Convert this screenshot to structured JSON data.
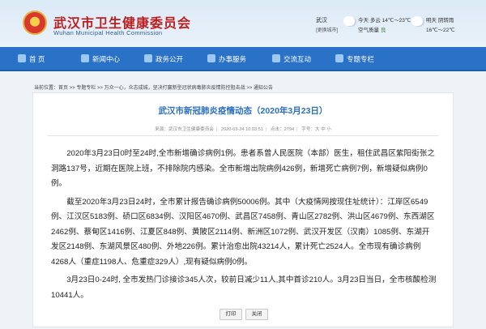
{
  "header": {
    "site_name_cn": "武汉市卫生健康委员会",
    "site_name_en": "Wuhan Municipal Health Commission",
    "weather": {
      "city": "武汉",
      "city_sub": "[更换城市]",
      "today_label": "今天",
      "today_desc": "多云",
      "today_temp": "14℃～23℃",
      "aqi_label": "空气质量",
      "aqi_value": "良",
      "tomorrow_label": "明天",
      "tomorrow_desc": "阴转雨",
      "tomorrow_temp": "16℃～22℃"
    }
  },
  "nav": {
    "items": [
      {
        "label": "首 页",
        "icon": "home-icon"
      },
      {
        "label": "新闻中心",
        "icon": "megaphone-icon"
      },
      {
        "label": "政务公开",
        "icon": "document-icon"
      },
      {
        "label": "办事服务",
        "icon": "screen-icon"
      },
      {
        "label": "交流互动",
        "icon": "chat-icon"
      },
      {
        "label": "专题专栏",
        "icon": "lightbulb-icon"
      }
    ]
  },
  "breadcrumb": "当前位置：首页 >> 专题专栏 >> 万众一心，众志成城，坚决打赢新型冠状病毒肺炎疫情防控阻击战 >> 通知公告",
  "article": {
    "title": "武汉市新冠肺炎疫情动态（2020年3月23日）",
    "meta_source": "来源：武汉市卫生健康委员会",
    "meta_date": "2020-03-24 10:03:51",
    "meta_views_label": "点击：",
    "meta_views": "2794",
    "meta_font_label": "字号：",
    "meta_font_opts": "大 中 小",
    "paragraphs": [
      "2020年3月23日0时至24时,全市新增确诊病例1例。患者系曾人民医院（本部）医生，租住武昌区紫阳街张之洞路137号，近期在医院上班，不排除院内感染。全市新增出院病例426例，新增死亡病例7例，新增疑似病例0例。",
      "截至2020年3月23日24时，全市累计报告确诊病例50006例。其中（大疫情网按现住址统计）：江岸区6549例、江汉区5183例、硚口区6834例、汉阳区4670例、武昌区7458例、青山区2782例、洪山区4679例、东西湖区2462例、蔡甸区1416例、江夏区848例、黄陂区2114例、新洲区1072例、武汉开发区（汉南）1085例、东湖开发区2148例、东湖风景区480例、外地226例。累计治愈出院43214人，累计死亡2524人。全市现有确诊病例4268人（重症1198人、危重症329人）,现有疑似病例0例。",
      "3月23日0-24时, 全市发热门诊接诊345人次，较前日减少11人,其中首诊210人。3月23日当日，全市核酸检测10441人。"
    ],
    "print_label": "打印",
    "close_label": "关闭"
  }
}
